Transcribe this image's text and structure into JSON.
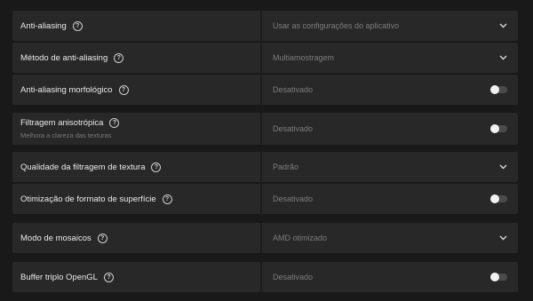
{
  "settings": [
    {
      "label": "Anti-aliasing",
      "help": "?",
      "value": "Usar as configurações do aplicativo",
      "control": "dropdown",
      "icon": "chevron-down-icon"
    },
    {
      "label": "Método de anti-aliasing",
      "help": "?",
      "value": "Multiamostragem",
      "control": "dropdown",
      "icon": "chevron-down-icon"
    },
    {
      "label": "Anti-aliasing morfológico",
      "help": "?",
      "value": "Desativado",
      "control": "toggle",
      "toggle_on": false
    },
    {
      "label": "Filtragem anisotrópica",
      "help": "?",
      "sublabel": "Melhora a clareza das texturas",
      "value": "Desativado",
      "control": "toggle",
      "toggle_on": false
    },
    {
      "label": "Qualidade da filtragem de textura",
      "help": "?",
      "value": "Padrão",
      "control": "dropdown",
      "icon": "chevron-down-icon"
    },
    {
      "label": "Otimização de formato de superfície",
      "help": "?",
      "value": "Desativado",
      "control": "toggle",
      "toggle_on": false
    },
    {
      "label": "Modo de mosaicos",
      "help": "?",
      "value": "AMD otimizado",
      "control": "dropdown",
      "icon": "chevron-down-icon"
    },
    {
      "label": "Buffer triplo OpenGL",
      "help": "?",
      "value": "Desativado",
      "control": "toggle",
      "toggle_on": false
    }
  ]
}
